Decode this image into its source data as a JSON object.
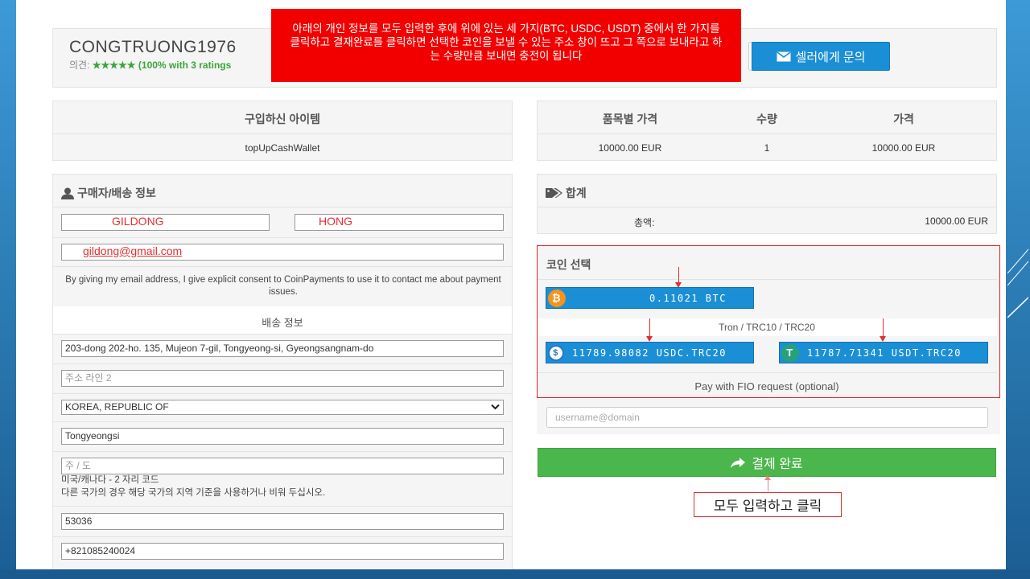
{
  "seller": {
    "name": "CONGTRUONG1976",
    "rating_label": "의견:",
    "stars": "★★★★★",
    "rating_text": "(100% with 3 ratings",
    "contact_button": "셀러에게 문의"
  },
  "note": {
    "text": "아래의 개인 정보를 모두 입력한 후에 위에 있는 세 가지(BTC, USDC, USDT) 중에서 한 가지를 클릭하고 결재완료를 클릭하면 선택한 코인을 보낼 수 있는 주소 창이 뜨고 그 쪽으로 보내라고 하는 수량만큼 보내면 충전이 됩니다"
  },
  "order": {
    "item_header": "구입하신 아이템",
    "item_name": "topUpCashWallet",
    "price_header": "품목별 가격",
    "qty_header": "수량",
    "total_header": "가격",
    "unit_price": "10000.00 EUR",
    "qty": "1",
    "line_total": "10000.00 EUR"
  },
  "buyer": {
    "title": "구매자/배송 정보",
    "first_name": "GILDONG",
    "last_name": "HONG",
    "email": "gildong@gmail.com",
    "consent": "By giving my email address, I give explicit consent to CoinPayments to use it to contact me about payment issues.",
    "shipping_title": "배송 정보",
    "address1": "203-dong 202-ho. 135, Mujeon 7-gil, Tongyeong-si, Gyeongsangnam-do",
    "address2_placeholder": "주소 라인 2",
    "country": "KOREA, REPUBLIC OF",
    "city": "Tongyeongsi",
    "state_placeholder": "주 / 도",
    "state_hint1": "미국/캐나다 - 2 자리 코드",
    "state_hint2": "다른 국가의 경우 해당 국가의 지역 기준을 사용하거나 비워 두십시오.",
    "zip": "53036",
    "phone": "+821085240024"
  },
  "summary": {
    "title": "합계",
    "total_label": "총액:",
    "total_value": "10000.00 EUR"
  },
  "coins": {
    "title": "코인 선택",
    "btc_amount": "0.11021 BTC",
    "tron_label": "Tron / TRC10 / TRC20",
    "usdc_amount": "11789.98082 USDC.TRC20",
    "usdt_amount": "11787.71341 USDT.TRC20",
    "fio_label": "Pay with FIO request (optional)",
    "fio_placeholder": "username@domain"
  },
  "checkout": {
    "pay_button": "결제 완료",
    "click_note": "모두 입력하고 클릭"
  },
  "colors": {
    "accent_blue": "#1b8fd6",
    "pay_green": "#4bb64b",
    "note_red": "#f20000"
  }
}
